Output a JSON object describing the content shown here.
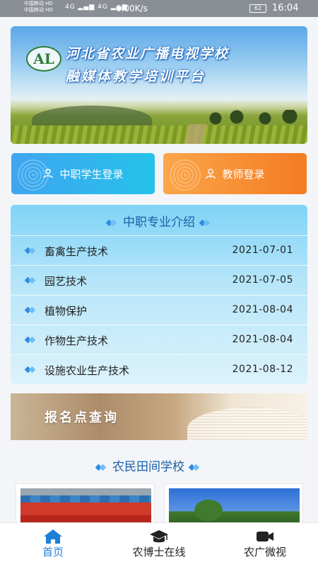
{
  "status_bar": {
    "carrier_1": "中国移动 HD",
    "carrier_2": "中国移动 HD",
    "network_icons": "4G ▂▄▆ 4G ▂▄▆",
    "speed": "0.00K/s",
    "battery": "62",
    "time": "16:04"
  },
  "banner": {
    "logo_text": "AL",
    "title": "河北省农业广播电视学校",
    "subtitle": "融媒体教学培训平台"
  },
  "login": {
    "student_label": "中职学生登录",
    "teacher_label": "教师登录"
  },
  "majors": {
    "title": "中职专业介绍",
    "items": [
      {
        "name": "畜禽生产技术",
        "date": "2021-07-01"
      },
      {
        "name": "园艺技术",
        "date": "2021-07-05"
      },
      {
        "name": "植物保护",
        "date": "2021-08-04"
      },
      {
        "name": "作物生产技术",
        "date": "2021-08-04"
      },
      {
        "name": "设施农业生产技术",
        "date": "2021-08-12"
      }
    ]
  },
  "signup_banner": {
    "label": "报名点查询"
  },
  "farm_school": {
    "title": "农民田间学校"
  },
  "tabbar": {
    "home": "首页",
    "doctor": "农博士在线",
    "video": "农广微视",
    "active_color": "#1e7fd6"
  },
  "colors": {
    "student_button": "#3fa5ef",
    "teacher_button": "#f47b22",
    "section_title": "#1b5fa8"
  }
}
